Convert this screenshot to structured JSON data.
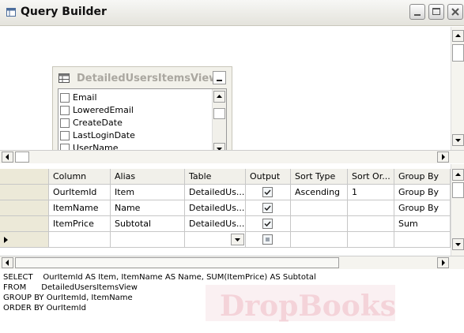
{
  "window": {
    "title": "Query Builder"
  },
  "diagram": {
    "table": {
      "title": "DetailedUsersItemsView",
      "columns": [
        "Email",
        "LoweredEmail",
        "CreateDate",
        "LastLoginDate",
        "UserName"
      ]
    }
  },
  "grid": {
    "headers": [
      "Column",
      "Alias",
      "Table",
      "Output",
      "Sort Type",
      "Sort Or...",
      "Group By"
    ],
    "rows": [
      {
        "column": "OurItemId",
        "alias": "Item",
        "table": "DetailedUs...",
        "output": true,
        "sort_type": "Ascending",
        "sort_order": "1",
        "group_by": "Group By"
      },
      {
        "column": "ItemName",
        "alias": "Name",
        "table": "DetailedUs...",
        "output": true,
        "sort_type": "",
        "sort_order": "",
        "group_by": "Group By"
      },
      {
        "column": "ItemPrice",
        "alias": "Subtotal",
        "table": "DetailedUs...",
        "output": true,
        "sort_type": "",
        "sort_order": "",
        "group_by": "Sum"
      }
    ]
  },
  "sql": {
    "lines": [
      "SELECT    OurItemId AS Item, ItemName AS Name, SUM(ItemPrice) AS Subtotal",
      "FROM      DetailedUsersItemsView",
      "GROUP BY OurItemId, ItemName",
      "ORDER BY OurItemId"
    ]
  },
  "watermark": {
    "text": "DropBooks"
  },
  "icons": {
    "app": "query-builder-icon",
    "table": "table-view-icon"
  },
  "colors": {
    "accent": "#c8102e",
    "selection": "#316ac5"
  }
}
